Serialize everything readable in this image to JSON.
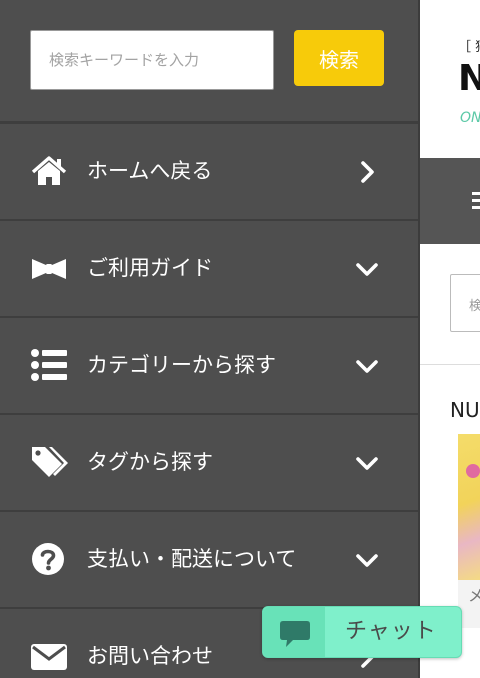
{
  "search": {
    "placeholder": "検索キーワードを入力",
    "button_label": "検索"
  },
  "menu": {
    "items": [
      {
        "label": "ホームへ戻る",
        "icon": "home-icon",
        "arrow": "chevron-right-icon"
      },
      {
        "label": "ご利用ガイド",
        "icon": "bow-tie-icon",
        "arrow": "chevron-down-icon"
      },
      {
        "label": "カテゴリーから探す",
        "icon": "list-icon",
        "arrow": "chevron-down-icon"
      },
      {
        "label": "タグから探す",
        "icon": "tags-icon",
        "arrow": "chevron-down-icon"
      },
      {
        "label": "支払い・配送について",
        "icon": "question-circle-icon",
        "arrow": "chevron-down-icon"
      },
      {
        "label": "お問い合わせ",
        "icon": "envelope-icon",
        "arrow": "chevron-right-icon"
      }
    ]
  },
  "chat": {
    "label": "チャット",
    "icon": "speech-bubble-icon"
  },
  "background_page": {
    "brand_top": "［ 猫",
    "logo_letter": "N",
    "logo_sub": "ON",
    "search_hint": "検",
    "section_title": "NU",
    "card_caption": "メ"
  },
  "colors": {
    "drawer_bg": "#4e4e4e",
    "search_button": "#f7cb0a",
    "chat_bg": "#7ff0cb",
    "chat_icon_bg": "#68e2b8",
    "accent_green": "#5cc9a7"
  }
}
